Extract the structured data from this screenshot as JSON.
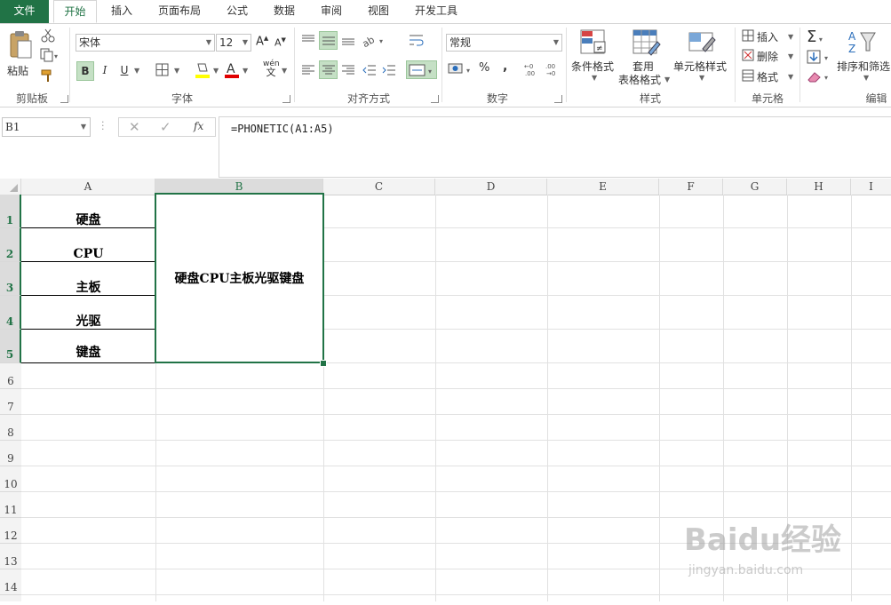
{
  "tabs": [
    "文件",
    "开始",
    "插入",
    "页面布局",
    "公式",
    "数据",
    "审阅",
    "视图",
    "开发工具"
  ],
  "ribbon": {
    "clipboard": {
      "paste": "粘贴",
      "label": "剪贴板"
    },
    "font": {
      "name": "宋体",
      "size": "12",
      "bold": "B",
      "italic": "I",
      "underline": "U",
      "phonetic": "wén",
      "label": "字体"
    },
    "alignment": {
      "label": "对齐方式"
    },
    "number": {
      "format": "常规",
      "percent": "%",
      "comma": ",",
      "label": "数字"
    },
    "styles": {
      "conditional": "条件格式",
      "table_top": "套用",
      "table_bottom": "表格格式",
      "cell_styles": "单元格样式",
      "label": "样式"
    },
    "cells": {
      "insert": "插入",
      "delete": "删除",
      "format": "格式",
      "label": "单元格"
    },
    "editing": {
      "sort_filter": "排序和筛选",
      "label": "编辑"
    }
  },
  "formula_bar": {
    "name_box": "B1",
    "fx": "fx",
    "formula": "=PHONETIC(A1:A5)"
  },
  "columns": [
    "A",
    "B",
    "C",
    "D",
    "E",
    "F",
    "G",
    "H",
    "I"
  ],
  "rows": [
    "1",
    "2",
    "3",
    "4",
    "5",
    "6",
    "7",
    "8",
    "9",
    "10",
    "11",
    "12",
    "13",
    "14"
  ],
  "cells": {
    "A1": "硬盘",
    "A2": "CPU",
    "A3": "主板",
    "A4": "光驱",
    "A5": "键盘",
    "B1": "硬盘CPU主板光驱键盘"
  },
  "watermark": {
    "brand": "Baidu经验",
    "url": "jingyan.baidu.com"
  },
  "colors": {
    "accent": "#217346",
    "selection": "#c5e0c5"
  }
}
